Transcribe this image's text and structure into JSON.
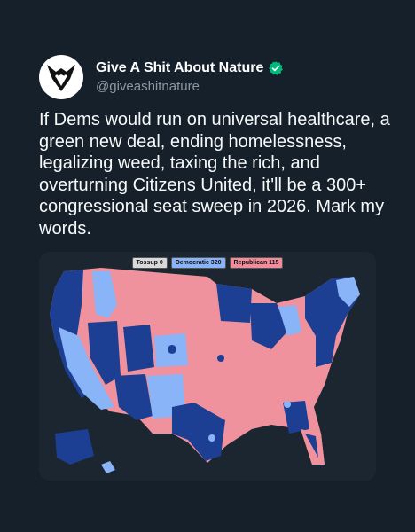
{
  "profile": {
    "display_name": "Give A Shit About Nature",
    "handle": "@giveashitnature",
    "avatar_icon": "wolf-logo-icon",
    "verified_icon": "verified-badge-icon",
    "verified_color": "#00ba7c"
  },
  "tweet": {
    "text": "If Dems would run on universal healthcare, a green new deal, ending homelessness, legalizing weed, taxing the rich, and overturning Citizens United, it'll be a 300+ congressional seat sweep in 2026. Mark my words."
  },
  "map": {
    "legend": [
      {
        "label": "Tossup 0",
        "color": "#d9d9d9"
      },
      {
        "label": "Democratic 320",
        "color": "#8ab4f8"
      },
      {
        "label": "Republican 115",
        "color": "#f28b9b"
      }
    ],
    "colors": {
      "dem_dark": "#1c3f94",
      "dem_light": "#89b4f7",
      "rep": "#f0929e"
    }
  }
}
